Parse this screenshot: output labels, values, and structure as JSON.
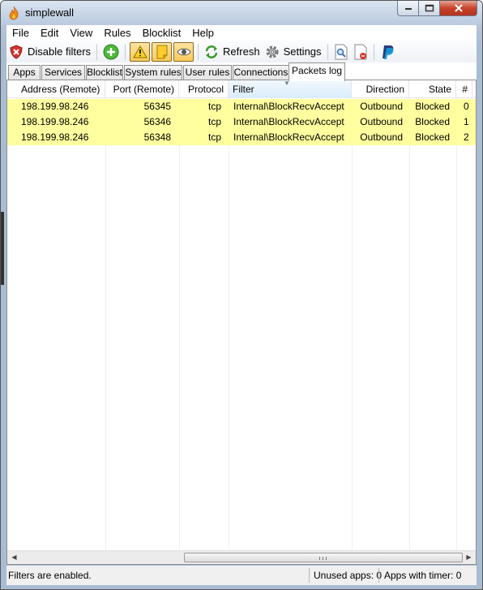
{
  "window": {
    "title": "simplewall"
  },
  "menu": [
    "File",
    "Edit",
    "View",
    "Rules",
    "Blocklist",
    "Help"
  ],
  "toolbar": {
    "disable_filters_label": "Disable filters",
    "refresh_label": "Refresh",
    "settings_label": "Settings"
  },
  "tabs": [
    "Apps",
    "Services",
    "Blocklist",
    "System rules",
    "User rules",
    "Connections",
    "Packets log"
  ],
  "active_tab": "Packets log",
  "table": {
    "columns": [
      "Address (Remote)",
      "Port (Remote)",
      "Protocol",
      "Filter",
      "Direction",
      "State",
      "#"
    ],
    "sorted_column": "Filter",
    "rows": [
      {
        "address": "198.199.98.246",
        "port": "56345",
        "protocol": "tcp",
        "filter": "Internal\\BlockRecvAccept",
        "direction": "Outbound",
        "state": "Blocked",
        "num": "0"
      },
      {
        "address": "198.199.98.246",
        "port": "56346",
        "protocol": "tcp",
        "filter": "Internal\\BlockRecvAccept",
        "direction": "Outbound",
        "state": "Blocked",
        "num": "1"
      },
      {
        "address": "198.199.98.246",
        "port": "56348",
        "protocol": "tcp",
        "filter": "Internal\\BlockRecvAccept",
        "direction": "Outbound",
        "state": "Blocked",
        "num": "2"
      }
    ],
    "row_highlight_color": "#ffff9f"
  },
  "status": {
    "filters": "Filters are enabled.",
    "unused_apps": "Unused apps: 0",
    "apps_with_timer": "Apps with timer: 0"
  }
}
